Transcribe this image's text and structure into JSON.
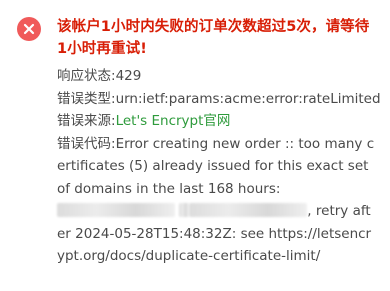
{
  "alert": {
    "title": "该帐户1小时内失败的订单次数超过5次，请等待1小时再重试!",
    "status_label": "响应状态:",
    "status_value": "429",
    "type_label": "错误类型:",
    "type_value": "urn:ietf:params:acme:error:rateLimited",
    "source_label": "错误来源:",
    "source_link": "Let's Encrypt官网",
    "code_label": "错误代码:",
    "code_value_part1": "Error creating new order :: too many certificates (5) already issued for this exact set of domains in the last 168 hours: ",
    "code_value_part2": ", retry after 2024-05-28T15:48:32Z: see https://letsencrypt.org/docs/duplicate-certificate-limit/"
  },
  "colors": {
    "error_icon": "#f05a5a",
    "title": "#d81e06",
    "link": "#2e9b3c",
    "text": "#4a4a4a"
  },
  "icons": {
    "error": "close-circle-icon"
  }
}
